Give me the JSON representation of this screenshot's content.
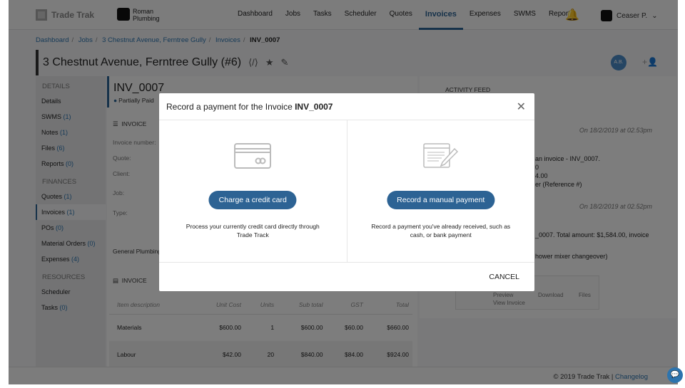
{
  "app": {
    "logo": "Trade Trak",
    "company_line1": "Roman",
    "company_line2": "Plumbing"
  },
  "nav": {
    "items": [
      "Dashboard",
      "Jobs",
      "Tasks",
      "Scheduler",
      "Quotes",
      "Invoices",
      "Expenses",
      "SWMS",
      "Reports"
    ],
    "active": "Invoices",
    "user": "Ceaser P."
  },
  "breadcrumb": [
    "Dashboard",
    "Jobs",
    "3 Chestnut Avenue, Ferntree Gully",
    "Invoices",
    "INV_0007"
  ],
  "page": {
    "title": "3 Chestnut Avenue, Ferntree Gully (#6)",
    "avatar": "A.B."
  },
  "sidebar": {
    "details_heading": "DETAILS",
    "finances_heading": "FINANCES",
    "resources_heading": "RESOURCES",
    "details": [
      {
        "label": "Details",
        "count": ""
      },
      {
        "label": "SWMS",
        "count": "(1)"
      },
      {
        "label": "Notes",
        "count": "(1)"
      },
      {
        "label": "Files",
        "count": "(6)"
      },
      {
        "label": "Reports",
        "count": "(0)"
      }
    ],
    "finances": [
      {
        "label": "Quotes",
        "count": "(1)"
      },
      {
        "label": "Invoices",
        "count": "(1)"
      },
      {
        "label": "POs",
        "count": "(0)"
      },
      {
        "label": "Material Orders",
        "count": "(0)"
      },
      {
        "label": "Expenses",
        "count": "(4)"
      }
    ],
    "resources": [
      {
        "label": "Scheduler",
        "count": ""
      },
      {
        "label": "Tasks",
        "count": "(0)"
      }
    ]
  },
  "invoice": {
    "number": "INV_0007",
    "status": "Partially Paid",
    "section1": "INVOICE",
    "section2": "INVOICE",
    "fields": [
      "Invoice number:",
      "Quote:",
      "Client:",
      "Job:",
      "Type:"
    ],
    "type_value": "General Plumbing",
    "columns": [
      "Item description",
      "Unit Cost",
      "Units",
      "Sub total",
      "GST",
      "Total"
    ],
    "rows": [
      [
        "Materials",
        "$600.00",
        "1",
        "$600.00",
        "$60.00",
        "$660.00"
      ],
      [
        "Labour",
        "$42.00",
        "20",
        "$840.00",
        "$84.00",
        "$924.00"
      ]
    ]
  },
  "feed": {
    "title": "ACTIVITY FEED",
    "date1": "On 18/2/2019 at 02.53pm",
    "date2": "On 18/2/2019 at 02.52pm",
    "lines1": [
      "an invoice - INV_0007.",
      "0",
      "4.00",
      "er (Reference #)"
    ],
    "lines2": [
      "_0007. Total amount: $1,584.00, invoice",
      "hower mixer changeover)"
    ],
    "preview": "Preview",
    "download": "Download",
    "files": "Files",
    "view": "View Invoice"
  },
  "footer": {
    "copyright": "© 2019 Trade Trak | ",
    "changelog": "Changelog"
  },
  "modal": {
    "title_prefix": "Record a payment for the Invoice ",
    "title_invoice": "INV_0007",
    "card_button": "Charge a credit card",
    "card_desc": "Process your currently credit card directly through Trade Track",
    "manual_button": "Record a manual payment",
    "manual_desc": "Record a payment you've already received, such as cash, or bank payment",
    "cancel": "CANCEL"
  },
  "colors": {
    "accent": "#2d6394",
    "link": "#2d74ae"
  }
}
